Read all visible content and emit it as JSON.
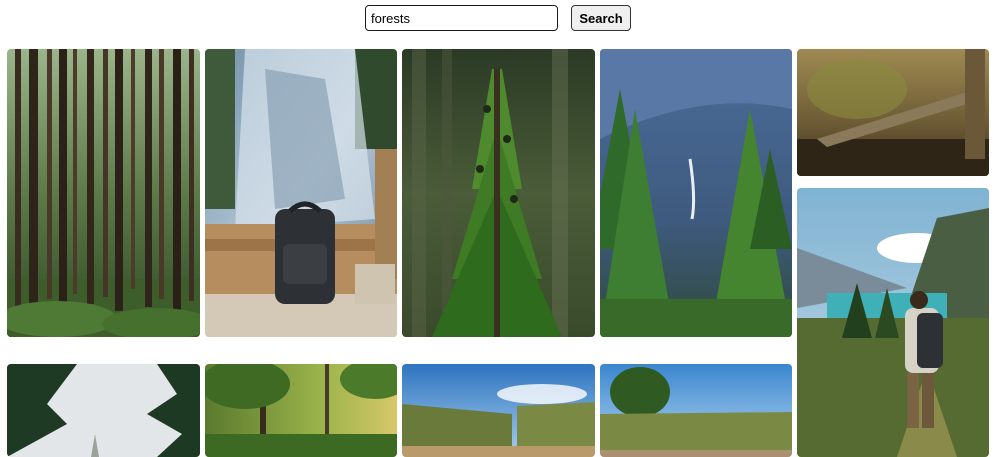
{
  "search": {
    "query": "forests",
    "placeholder": "",
    "button_label": "Search"
  },
  "colors": {
    "page_background": "#ffffff",
    "button_background": "#efefef",
    "input_border": "#1a1a1a"
  },
  "gallery": {
    "items": [
      {
        "name": "tall-pine-forest-photo"
      },
      {
        "name": "waterfall-backpack-photo"
      },
      {
        "name": "young-fir-tree-photo"
      },
      {
        "name": "mountain-valley-forest-photo"
      },
      {
        "name": "fallen-log-stream-photo"
      },
      {
        "name": "hiker-mountain-lake-photo"
      },
      {
        "name": "tree-canopy-sky-photo"
      },
      {
        "name": "sunlit-forest-photo"
      },
      {
        "name": "reed-field-path-photo"
      },
      {
        "name": "reed-field-trees-photo"
      }
    ]
  }
}
